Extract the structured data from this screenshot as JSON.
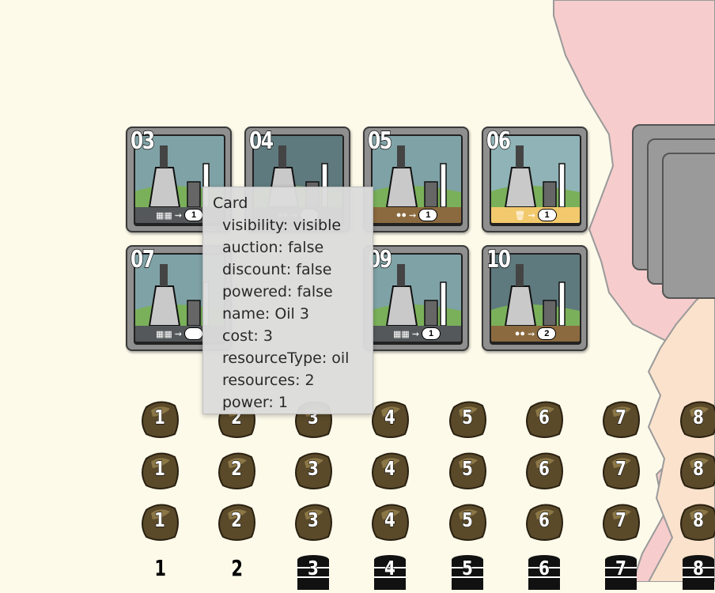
{
  "board": {
    "map_colors": {
      "region_pink": "#f6cccc",
      "region_peach": "#fbe2cc",
      "background": "#fdfaea",
      "border": "#999999"
    },
    "deck_label": "",
    "power_plants": [
      {
        "number": "03",
        "resource": "oil",
        "cost_icons": "2 oil",
        "powers": "1",
        "band_color": "#54585a"
      },
      {
        "number": "04",
        "resource": "coal",
        "cost_icons": "",
        "powers": "",
        "band_color": "#54585a"
      },
      {
        "number": "05",
        "resource": "hybrid",
        "cost_icons": "2 hybrid",
        "powers": "1",
        "band_color": "#8b6a3f"
      },
      {
        "number": "06",
        "resource": "garbage",
        "cost_icons": "1 garbage",
        "powers": "1",
        "band_color": "#f2c96c"
      },
      {
        "number": "07",
        "resource": "oil",
        "cost_icons": "3 oil",
        "powers": "",
        "band_color": "#54585a"
      },
      {
        "number": "09",
        "resource": "oil",
        "cost_icons": "1 oil",
        "powers": "1",
        "band_color": "#54585a"
      },
      {
        "number": "10",
        "resource": "coal",
        "cost_icons": "2 coal",
        "powers": "2",
        "band_color": "#8b6a3f"
      }
    ],
    "resource_market": {
      "coal_rows": [
        [
          "1",
          "2",
          "3",
          "4",
          "5",
          "6",
          "7",
          "8"
        ],
        [
          "1",
          "2",
          "3",
          "4",
          "5",
          "6",
          "7",
          "8"
        ],
        [
          "1",
          "2",
          "3",
          "4",
          "5",
          "6",
          "7",
          "8"
        ]
      ],
      "oil_row": [
        "1",
        "2",
        "3",
        "4",
        "5",
        "6",
        "7",
        "8"
      ]
    }
  },
  "tooltip": {
    "title": "Card",
    "fields": [
      "visibility: visible",
      "auction: false",
      "discount: false",
      "powered: false",
      "name: Oil 3",
      "cost: 3",
      "resourceType: oil",
      "resources: 2",
      "power: 1"
    ]
  }
}
